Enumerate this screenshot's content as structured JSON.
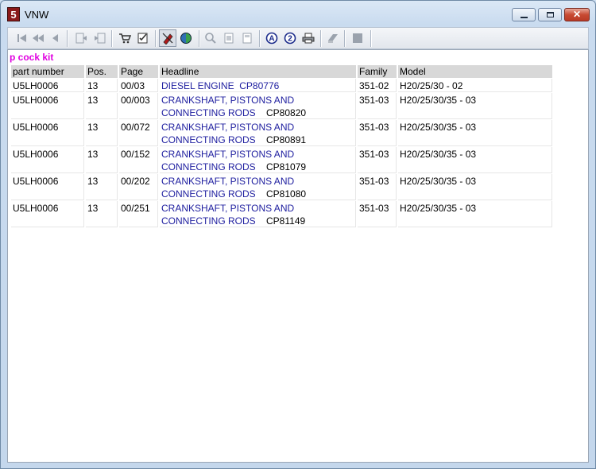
{
  "window": {
    "title": "VNW",
    "icon": "app-icon-5"
  },
  "toolbar": {
    "icons": [
      "first-page-icon",
      "previous-fast-icon",
      "previous-icon",
      "back-icon",
      "forward-icon",
      "cart-icon",
      "checklist-icon",
      "marker-icon",
      "globe-icon",
      "zoom-icon",
      "page-icon",
      "page-fit-icon",
      "circle-a-icon",
      "circle-2-icon",
      "print-icon",
      "eraser-icon",
      "stop-icon"
    ]
  },
  "content": {
    "kit_title": "p cock kit",
    "columns": [
      "part number",
      "Pos.",
      "Page",
      "Headline",
      "Family",
      "Model"
    ],
    "rows": [
      {
        "part_number": "U5LH0006",
        "pos": "13",
        "page": "00/03",
        "headline_1": "DIESEL ENGINE",
        "headline_2": "",
        "cp": "CP80776",
        "family": "351-02",
        "model": "H20/25/30 - 02"
      },
      {
        "part_number": "U5LH0006",
        "pos": "13",
        "page": "00/003",
        "headline_1": "CRANKSHAFT, PISTONS AND",
        "headline_2": "CONNECTING RODS",
        "cp": "CP80820",
        "family": "351-03",
        "model": "H20/25/30/35 - 03"
      },
      {
        "part_number": "U5LH0006",
        "pos": "13",
        "page": "00/072",
        "headline_1": "CRANKSHAFT, PISTONS AND",
        "headline_2": "CONNECTING RODS",
        "cp": "CP80891",
        "family": "351-03",
        "model": "H20/25/30/35 - 03"
      },
      {
        "part_number": "U5LH0006",
        "pos": "13",
        "page": "00/152",
        "headline_1": "CRANKSHAFT, PISTONS AND",
        "headline_2": "CONNECTING RODS",
        "cp": "CP81079",
        "family": "351-03",
        "model": "H20/25/30/35 - 03"
      },
      {
        "part_number": "U5LH0006",
        "pos": "13",
        "page": "00/202",
        "headline_1": "CRANKSHAFT, PISTONS AND",
        "headline_2": "CONNECTING RODS",
        "cp": "CP81080",
        "family": "351-03",
        "model": "H20/25/30/35 - 03"
      },
      {
        "part_number": "U5LH0006",
        "pos": "13",
        "page": "00/251",
        "headline_1": "CRANKSHAFT, PISTONS AND",
        "headline_2": "CONNECTING RODS",
        "cp": "CP81149",
        "family": "351-03",
        "model": "H20/25/30/35 - 03"
      }
    ]
  },
  "colors": {
    "kit_title": "#e000e0",
    "headline_link": "#2020a0",
    "header_bg": "#d8d8d8"
  }
}
